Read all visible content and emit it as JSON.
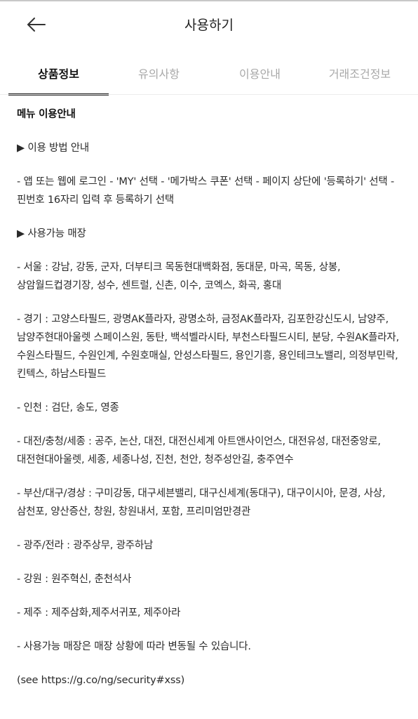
{
  "header": {
    "title": "사용하기"
  },
  "tabs": [
    {
      "label": "상품정보",
      "active": true
    },
    {
      "label": "유의사항",
      "active": false
    },
    {
      "label": "이용안내",
      "active": false
    },
    {
      "label": "거래조건정보",
      "active": false
    }
  ],
  "content": {
    "section_title": "메뉴 이용안내",
    "how_to_heading": "▶ 이용 방법 안내",
    "how_to_text": "- 앱 또는 웹에 로그인 - 'MY' 선택 - '메가박스 쿠폰' 선택 - 페이지 상단에 '등록하기' 선택 - 핀번호 16자리 입력 후 등록하기 선택",
    "stores_heading": "▶ 사용가능 매장",
    "stores": [
      "- 서울 : 강남, 강동, 군자, 더부티크 목동현대백화점, 동대문, 마곡, 목동, 상봉, 상암월드컵경기장, 성수, 센트럴, 신촌, 이수, 코엑스, 화곡, 홍대",
      "- 경기 : 고양스타필드, 광명AK플라자, 광명소하, 금정AK플라자, 김포한강신도시, 남양주, 남양주현대아울렛 스페이스원, 동탄, 백석벨라시타, 부천스타필드시티, 분당, 수원AK플라자, 수원스타필드, 수원인계, 수원호매실, 안성스타필드, 용인기흥, 용인테크노밸리, 의정부민락, 킨텍스, 하남스타필드",
      "- 인천 : 검단, 송도, 영종",
      "- 대전/충청/세종 : 공주, 논산, 대전, 대전신세계 아트앤사이언스, 대전유성, 대전중앙로, 대전현대아울렛, 세종, 세종나성, 진천, 천안, 청주성안길, 충주연수",
      "- 부산/대구/경상 : 구미강동, 대구세븐밸리, 대구신세계(동대구), 대구이시아, 문경, 사상, 삼천포, 양산증산, 창원, 창원내서, 포함, 프리미엄만경관",
      "- 광주/전라 : 광주상무, 광주하남",
      "- 강원 : 원주혁신, 춘천석사",
      "- 제주 : 제주삼화,제주서귀포, 제주아라"
    ],
    "notice": "- 사용가능 매장은 매장 상황에 따라 변동될 수 있습니다.",
    "footer_note": "(see https://g.co/ng/security#xss)"
  },
  "icons": {
    "back": "arrow-left-icon"
  }
}
